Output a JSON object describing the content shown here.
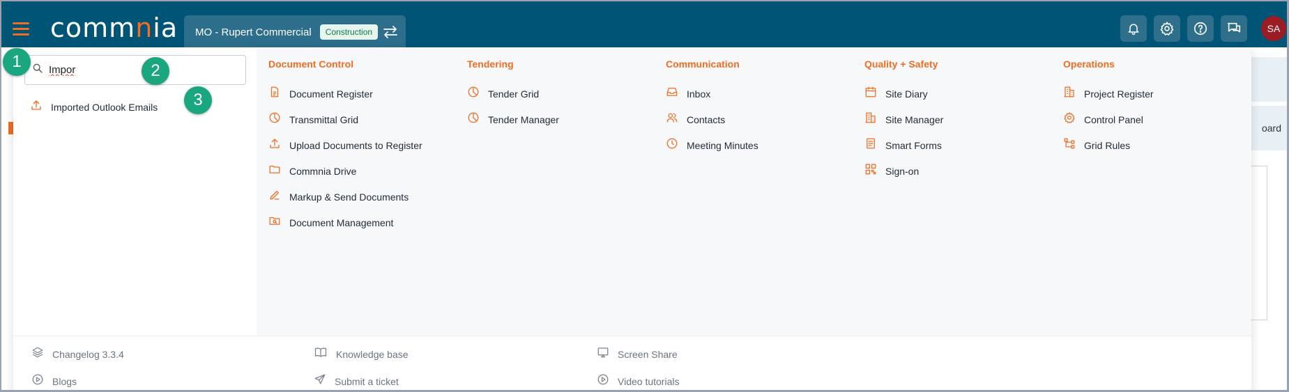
{
  "header": {
    "logo_text_1": "comm",
    "logo_text_2": "n",
    "logo_text_3": "ia",
    "project_name": "MO - Rupert Commercial",
    "project_badge": "Construction",
    "avatar_initials": "SA",
    "accent_color": "#f26c22",
    "bar_color": "#005577",
    "actions": [
      "bell-icon",
      "gear-icon",
      "help-icon",
      "chat-icon"
    ]
  },
  "background": {
    "partial_text": "oard"
  },
  "search": {
    "value": "Impor",
    "results": [
      {
        "label": "Imported Outlook Emails",
        "icon": "upload-icon"
      }
    ]
  },
  "menu": {
    "columns": [
      {
        "heading": "Document Control",
        "items": [
          {
            "label": "Document Register",
            "icon": "document-icon"
          },
          {
            "label": "Transmittal Grid",
            "icon": "pie-chart-icon"
          },
          {
            "label": "Upload Documents to Register",
            "icon": "upload-icon"
          },
          {
            "label": "Commnia Drive",
            "icon": "folder-icon"
          },
          {
            "label": "Markup & Send Documents",
            "icon": "pen-icon"
          },
          {
            "label": "Document Management",
            "icon": "folder-search-icon"
          }
        ]
      },
      {
        "heading": "Tendering",
        "items": [
          {
            "label": "Tender Grid",
            "icon": "pie-chart-icon"
          },
          {
            "label": "Tender Manager",
            "icon": "pie-chart-icon"
          }
        ]
      },
      {
        "heading": "Communication",
        "items": [
          {
            "label": "Inbox",
            "icon": "inbox-icon"
          },
          {
            "label": "Contacts",
            "icon": "contacts-icon"
          },
          {
            "label": "Meeting Minutes",
            "icon": "clock-icon"
          }
        ]
      },
      {
        "heading": "Quality + Safety",
        "items": [
          {
            "label": "Site Diary",
            "icon": "calendar-icon"
          },
          {
            "label": "Site Manager",
            "icon": "building-icon"
          },
          {
            "label": "Smart Forms",
            "icon": "form-icon"
          },
          {
            "label": "Sign-on",
            "icon": "qr-icon"
          }
        ]
      },
      {
        "heading": "Operations",
        "items": [
          {
            "label": "Project Register",
            "icon": "building-icon"
          },
          {
            "label": "Control Panel",
            "icon": "gear-icon"
          },
          {
            "label": "Grid Rules",
            "icon": "rules-icon"
          }
        ]
      }
    ]
  },
  "footer": {
    "links": [
      {
        "label": "Changelog 3.3.4",
        "icon": "layers-icon"
      },
      {
        "label": "Blogs",
        "icon": "play-circle-icon"
      },
      {
        "label": "Knowledge base",
        "icon": "book-icon"
      },
      {
        "label": "Submit a ticket",
        "icon": "send-icon"
      },
      {
        "label": "Screen Share",
        "icon": "cast-icon"
      },
      {
        "label": "Video tutorials",
        "icon": "play-circle-icon"
      }
    ]
  },
  "steps": [
    "1",
    "2",
    "3"
  ]
}
